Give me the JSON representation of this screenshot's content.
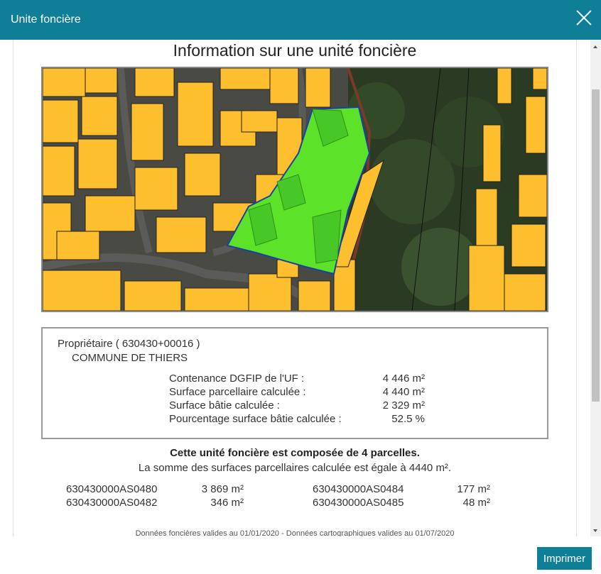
{
  "dialog": {
    "title": "Unite foncière"
  },
  "document": {
    "title": "Information sur une unité foncière",
    "owner_label": "Propriétaire ( 630430+00016 )",
    "owner_name": "COMMUNE DE THIERS",
    "stats": [
      {
        "label": "Contenance DGFIP de l'UF :",
        "value": "4 446 m²"
      },
      {
        "label": "Surface parcellaire calculée :",
        "value": "4 440 m²"
      },
      {
        "label": "Surface bâtie calculée :",
        "value": "2 329 m²"
      },
      {
        "label": "Pourcentage surface bâtie calculée :",
        "value": "52.5 %"
      }
    ],
    "summary_title": "Cette unité foncière est composée de 4 parcelles.",
    "summary_text": "La somme des surfaces parcellaires calculée est égale à 4440 m².",
    "parcels": [
      {
        "id": "630430000AS0480",
        "surface": "3 869 m²"
      },
      {
        "id": "630430000AS0482",
        "surface": "346 m²"
      },
      {
        "id": "630430000AS0484",
        "surface": "177 m²"
      },
      {
        "id": "630430000AS0485",
        "surface": "48 m²"
      }
    ],
    "footnote": "Données foncières valides au 01/01/2020 - Données cartographiques valides au 01/07/2020"
  },
  "actions": {
    "print_label": "Imprimer"
  },
  "icons": {
    "close": "close-icon"
  },
  "colors": {
    "header": "#0e7f97",
    "building": "#fdbf2d",
    "selected_parcel": "#5de22a",
    "parcel_outline": "#1a3fa8"
  }
}
